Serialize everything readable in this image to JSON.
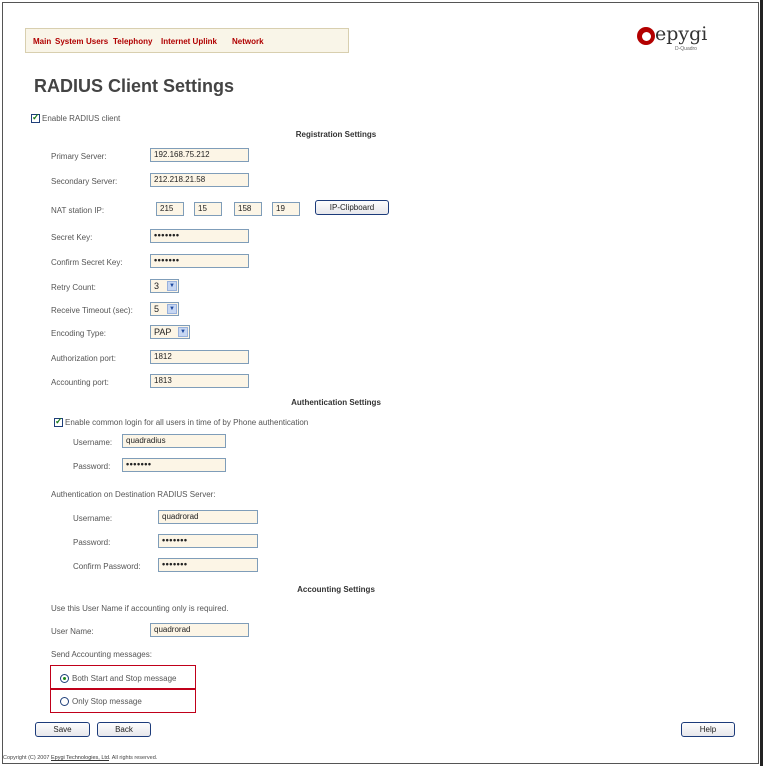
{
  "menu": [
    "Main",
    "System",
    "Users",
    "Telephony",
    "Internet Uplink",
    "Network"
  ],
  "logo": {
    "word": "epygi",
    "sub": "D-Quadro"
  },
  "title": "RADIUS Client Settings",
  "enable_radius_label": "Enable RADIUS client",
  "registration": {
    "heading": "Registration Settings",
    "primary_label": "Primary Server:",
    "primary_value": "192.168.75.212",
    "secondary_label": "Secondary Server:",
    "secondary_value": "212.218.21.58",
    "nat_label": "NAT station IP:",
    "nat_octets": [
      "215",
      "15",
      "158",
      "19"
    ],
    "ip_clipboard": "IP-Clipboard",
    "secret_label": "Secret Key:",
    "secret_value": "•••••••",
    "confirm_secret_label": "Confirm Secret Key:",
    "confirm_secret_value": "•••••••",
    "retry_label": "Retry Count:",
    "retry_value": "3",
    "timeout_label": "Receive Timeout (sec):",
    "timeout_value": "5",
    "encoding_label": "Encoding Type:",
    "encoding_value": "PAP",
    "auth_port_label": "Authorization port:",
    "auth_port_value": "1812",
    "acct_port_label": "Accounting port:",
    "acct_port_value": "1813"
  },
  "authentication": {
    "heading": "Authentication Settings",
    "common_login_label": "Enable common login for all users in time of by Phone authentication",
    "username_label": "Username:",
    "username_value": "quadradius",
    "password_label": "Password:",
    "password_value": "•••••••",
    "dest_label": "Authentication on Destination RADIUS Server:",
    "dest_username_label": "Username:",
    "dest_username_value": "quadrorad",
    "dest_password_label": "Password:",
    "dest_password_value": "•••••••",
    "dest_confirm_label": "Confirm Password:",
    "dest_confirm_value": "•••••••"
  },
  "accounting": {
    "heading": "Accounting Settings",
    "note": "Use this User Name if accounting only is required.",
    "username_label": "User Name:",
    "username_value": "quadrorad",
    "send_label": "Send Accounting messages:",
    "option_both": "Both Start and Stop message",
    "option_stop": "Only Stop message"
  },
  "buttons": {
    "save": "Save",
    "back": "Back",
    "help": "Help"
  },
  "footer": {
    "prefix": "Copyright (C) 2007 ",
    "link": "Epygi Technologies, Ltd",
    "suffix": ". All rights reserved."
  }
}
